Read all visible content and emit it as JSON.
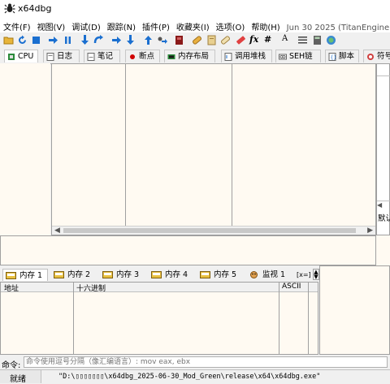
{
  "window": {
    "title": "x64dbg"
  },
  "menu": {
    "items": [
      "文件(F)",
      "视图(V)",
      "调试(D)",
      "跟踪(N)",
      "插件(P)",
      "收藏夹(I)",
      "选项(O)",
      "帮助(H)"
    ],
    "build_info": "Jun 30 2025 (TitanEngine)"
  },
  "toolbar": {
    "icons": [
      "open-icon",
      "restart-icon",
      "stop-icon",
      "run-icon",
      "pause-icon",
      "step-into-icon",
      "step-over-icon",
      "trace-into-icon",
      "trace-over-icon",
      "execute-till-return-icon",
      "run-to-user-code-icon",
      "memory-map-icon",
      "patch-icon",
      "comment-icon",
      "label-icon",
      "bookmark-icon",
      "function-icon",
      "hash-icon",
      "font-icon",
      "list-icon",
      "calculator-icon",
      "help-icon"
    ],
    "fx_label": "fx",
    "hash_label": "#",
    "font_label": "A"
  },
  "tabs": [
    "CPU",
    "日志",
    "笔记",
    "断点",
    "内存布局",
    "调用堆栈",
    "SEH链",
    "脚本",
    "符号"
  ],
  "dump_tabs": [
    "内存 1",
    "内存 2",
    "内存 3",
    "内存 4",
    "内存 5",
    "监视 1"
  ],
  "dump_extra": "[x=]",
  "dump_columns": {
    "address": "地址",
    "hex": "十六进制",
    "ascii": "ASCII"
  },
  "side_label": "默认",
  "command": {
    "label": "命令:",
    "placeholder": "命令使用逗号分隔（像汇编语言）: mov eax, ebx"
  },
  "status": {
    "state": "就绪",
    "path": "\"D:\\▯▯▯▯▯▯▯\\x64dbg_2025-06-30_Mod_Green\\release\\x64\\x64dbg.exe\""
  },
  "colors": {
    "pane_bg": "#fffaf2",
    "breakpoint_red": "#d00000",
    "accent_blue": "#1a6fd0"
  }
}
